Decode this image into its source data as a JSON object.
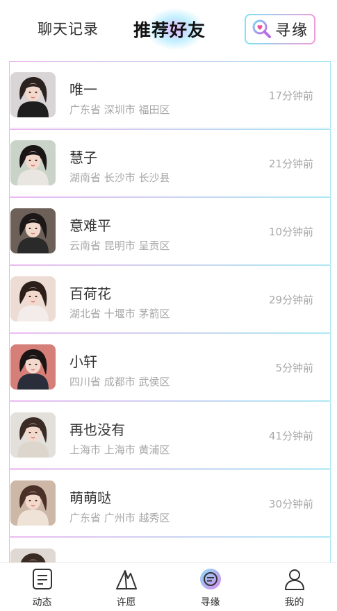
{
  "header": {
    "tab_chat": "聊天记录",
    "tab_recommend": "推荐好友",
    "seek_label": "寻缘"
  },
  "friends": [
    {
      "name": "唯一",
      "location": "广东省 深圳市 福田区",
      "time": "17分钟前",
      "hair": "#2b2220",
      "bg": "#d9d4d6",
      "cloth": "#1e1e1e"
    },
    {
      "name": "慧子",
      "location": "湖南省 长沙市 长沙县",
      "time": "21分钟前",
      "hair": "#1b1616",
      "bg": "#c9d3c8",
      "cloth": "#e9e6e2"
    },
    {
      "name": "意难平",
      "location": "云南省 昆明市 呈贡区",
      "time": "10分钟前",
      "hair": "#1d1818",
      "bg": "#6d6058",
      "cloth": "#2a2a2a"
    },
    {
      "name": "百荷花",
      "location": "湖北省 十堰市 茅箭区",
      "time": "29分钟前",
      "hair": "#2c1e1a",
      "bg": "#ecdcd4",
      "cloth": "#f3ecea"
    },
    {
      "name": "小轩",
      "location": "四川省 成都市 武侯区",
      "time": "5分钟前",
      "hair": "#1a1414",
      "bg": "#d67e78",
      "cloth": "#2a2e3a"
    },
    {
      "name": "再也没有",
      "location": "上海市 上海市 黄浦区",
      "time": "41分钟前",
      "hair": "#3a2c25",
      "bg": "#e3e0db",
      "cloth": "#ddd6cc"
    },
    {
      "name": "萌萌哒",
      "location": "广东省 广州市 越秀区",
      "time": "30分钟前",
      "hair": "#4a3026",
      "bg": "#cdb8a8",
      "cloth": "#efe3d8"
    },
    {
      "name": "",
      "location": "",
      "time": "",
      "hair": "#3a2a24",
      "bg": "#e0d8d2",
      "cloth": "#e8e0da"
    }
  ],
  "nav": [
    {
      "label": "动态",
      "icon": "feed-icon"
    },
    {
      "label": "许愿",
      "icon": "wish-icon"
    },
    {
      "label": "寻缘",
      "icon": "seek-icon",
      "active": true
    },
    {
      "label": "我的",
      "icon": "profile-icon"
    }
  ]
}
